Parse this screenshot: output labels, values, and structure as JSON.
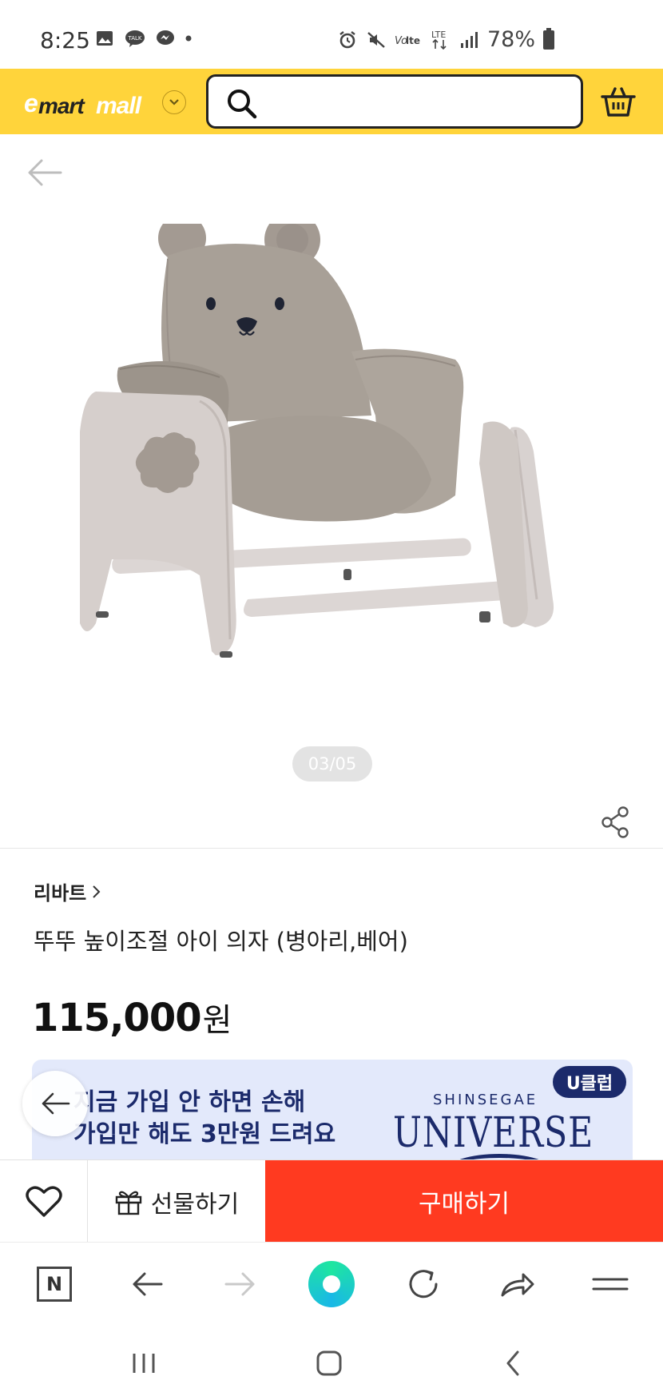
{
  "status_bar": {
    "time": "8:25",
    "battery_percent": "78%",
    "left_icons": [
      "gallery-icon",
      "talk-icon",
      "messenger-icon",
      "dot-icon"
    ],
    "right_icons": [
      "alarm-icon",
      "mute-icon",
      "volte-icon",
      "lte-icon",
      "signal-icon",
      "battery-icon"
    ]
  },
  "header": {
    "logo": "emart mall",
    "search_placeholder": "",
    "brand_color": "#ffd43b"
  },
  "gallery": {
    "pager": "03/05"
  },
  "product": {
    "brand": "리바트",
    "title": "뚜뚜 높이조절 아이 의자 (병아리,베어)",
    "price": "115,000",
    "currency": "원"
  },
  "banner": {
    "line1": "지금 가입 안 하면 손해",
    "line2": "가입만 해도 3만원 드려요",
    "badge": "U클럽",
    "brand_small": "SHINSEGAE",
    "brand_big": "UNIVERSE"
  },
  "actions": {
    "gift_label": "선물하기",
    "buy_label": "구매하기",
    "buy_color": "#ff3a20"
  },
  "browser_bar": {
    "home_label": "N"
  }
}
